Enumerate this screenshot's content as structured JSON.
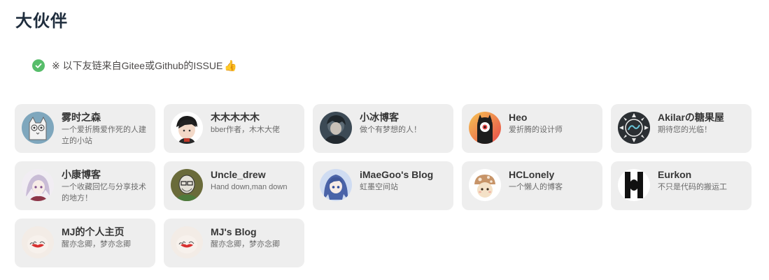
{
  "section": {
    "title": "大伙伴",
    "notice": "※ 以下友链来自Gitee或Github的ISSUE",
    "notice_icon": "check-circle-icon",
    "notice_emoji": "👍"
  },
  "colors": {
    "card_bg": "#eeeeee",
    "check_green": "#57bd6a",
    "title_color": "#1f2d3d"
  },
  "friends": [
    {
      "name": "雾时之森",
      "desc": "一个爱折腾爱作死的人建立的小站",
      "avatar": "cat-avatar-icon"
    },
    {
      "name": "木木木木木",
      "desc": "bber作者，木木大佬",
      "avatar": "boy-avatar-icon"
    },
    {
      "name": "小冰博客",
      "desc": "做个有梦想的人！",
      "avatar": "dark-character-avatar-icon"
    },
    {
      "name": "Heo",
      "desc": "爱折腾的设计师",
      "avatar": "monster-avatar-icon"
    },
    {
      "name": "Akilarの糖果屋",
      "desc": "期待您的光临！",
      "avatar": "akilar-logo-icon"
    },
    {
      "name": "小康博客",
      "desc": "一个收藏回忆与分享技术的地方！",
      "avatar": "anime-girl-avatar-icon"
    },
    {
      "name": "Uncle_drew",
      "desc": "Hand down,man down",
      "avatar": "old-man-avatar-icon"
    },
    {
      "name": "iMaeGoo's Blog",
      "desc": "虹墨空间站",
      "avatar": "blue-hair-avatar-icon"
    },
    {
      "name": "HCLonely",
      "desc": "一个懒人的博客",
      "avatar": "mushroom-avatar-icon"
    },
    {
      "name": "Eurkon",
      "desc": "不只是代码的搬运工",
      "avatar": "eurkon-logo-icon"
    },
    {
      "name": "MJ的个人主页",
      "desc": "醒亦念卿，梦亦念卿",
      "avatar": "mj-avatar-icon"
    },
    {
      "name": "MJ's Blog",
      "desc": "醒亦念卿，梦亦念卿",
      "avatar": "mj-avatar-icon"
    }
  ]
}
